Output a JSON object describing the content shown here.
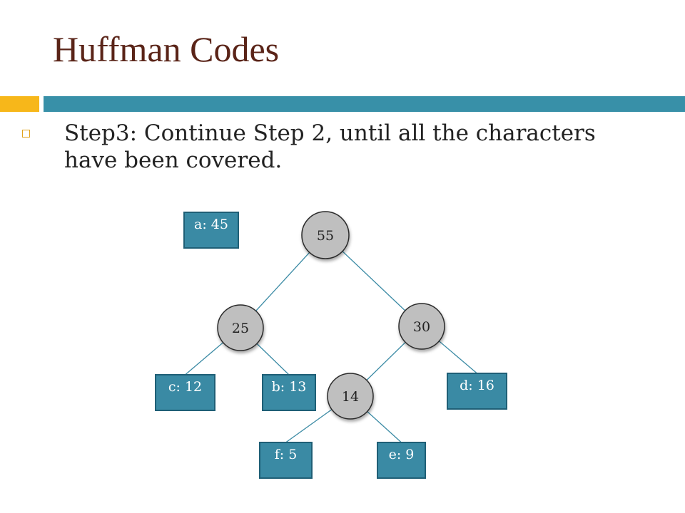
{
  "title": "Huffman Codes",
  "bullet": {
    "line1": "Step3: Continue Step 2, until all the characters",
    "line2": "have been covered."
  },
  "tree": {
    "nodes": [
      {
        "id": "n55",
        "label": "55"
      },
      {
        "id": "n25",
        "label": "25"
      },
      {
        "id": "n30",
        "label": "30"
      },
      {
        "id": "n14",
        "label": "14"
      }
    ],
    "leaves": [
      {
        "id": "la",
        "label": "a: 45"
      },
      {
        "id": "lc",
        "label": "c: 12"
      },
      {
        "id": "lb",
        "label": "b: 13"
      },
      {
        "id": "ld",
        "label": "d: 16"
      },
      {
        "id": "lf",
        "label": "f: 5"
      },
      {
        "id": "le",
        "label": "e: 9"
      }
    ],
    "edges": [
      [
        "n55",
        "n25"
      ],
      [
        "n55",
        "n30"
      ],
      [
        "n25",
        "lc"
      ],
      [
        "n25",
        "lb"
      ],
      [
        "n30",
        "n14"
      ],
      [
        "n30",
        "ld"
      ],
      [
        "n14",
        "lf"
      ],
      [
        "n14",
        "le"
      ]
    ]
  },
  "colors": {
    "title": "#5a2418",
    "accent_orange": "#f7b71a",
    "accent_teal": "#3890a8",
    "leaf_fill": "#3a8aa4",
    "node_fill": "#bfbfbf"
  }
}
